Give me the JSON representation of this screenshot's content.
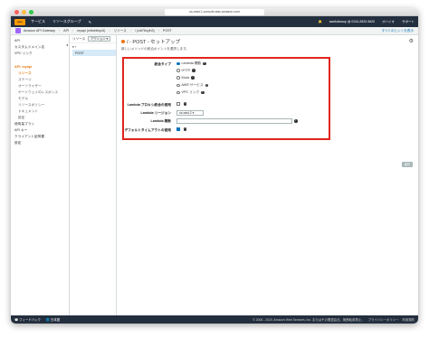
{
  "browser": {
    "url": "us-east-1.console.aws.amazon.com"
  },
  "awsnav": {
    "logo": "aws",
    "services": "サービス",
    "resource_groups": "リソースグループ",
    "account": "awsfollowup @ 0134-2820-9620",
    "region": "オハイオ",
    "support": "サポート"
  },
  "breadcrumb": {
    "service": "Amazon API Gateway",
    "items": [
      "API",
      "myapi (mlbvbtbyc5)",
      "リソース",
      "/ (vdt76nyih3)",
      "POST"
    ],
    "right": "すべてのヒントを表示"
  },
  "sidebar": {
    "items": [
      "API",
      "カスタムドメイン名",
      "VPC リンク"
    ],
    "api_label": "API: myapi",
    "sub_items": [
      "リソース",
      "ステージ",
      "オーソライザー",
      "ゲートウェイのレスポンス",
      "モデル",
      "リソースポリシー",
      "ドキュメント",
      "設定"
    ],
    "bottom_items": [
      "使用量プラン",
      "API キー",
      "クライアント証明書",
      "設定"
    ]
  },
  "tree": {
    "header": "リソース",
    "actions": "アクション",
    "root": "/",
    "child": "POST"
  },
  "content": {
    "title_prefix": "/ - POST - セットアップ",
    "subtitle": "新しいメソッドの統合ポイントを選択します。",
    "form": {
      "integration_type_label": "統合タイプ",
      "options": [
        "Lambda 関数",
        "HTTP",
        "Mock",
        "AWS サービス",
        "VPC リンク"
      ],
      "selected_option": "Lambda 関数",
      "proxy_label": "Lambda プロキシ統合の使用",
      "region_label": "Lambda リージョン",
      "region_value": "us-east-2",
      "function_label": "Lambda 関数",
      "function_value": "",
      "timeout_label": "デフォルトタイムアウトの使用"
    },
    "save_button": "保存"
  },
  "footer": {
    "feedback": "フィードバック",
    "language": "日本語",
    "copyright": "© 2008 - 2020, Amazon Web Services, Inc. またはその関連会社。無断転用禁止。",
    "privacy": "プライバシーポリシー",
    "terms": "利用規約"
  },
  "colors": {
    "accent": "#e47911",
    "highlight_box": "#e0251c",
    "nav_bg": "#232f3e"
  }
}
